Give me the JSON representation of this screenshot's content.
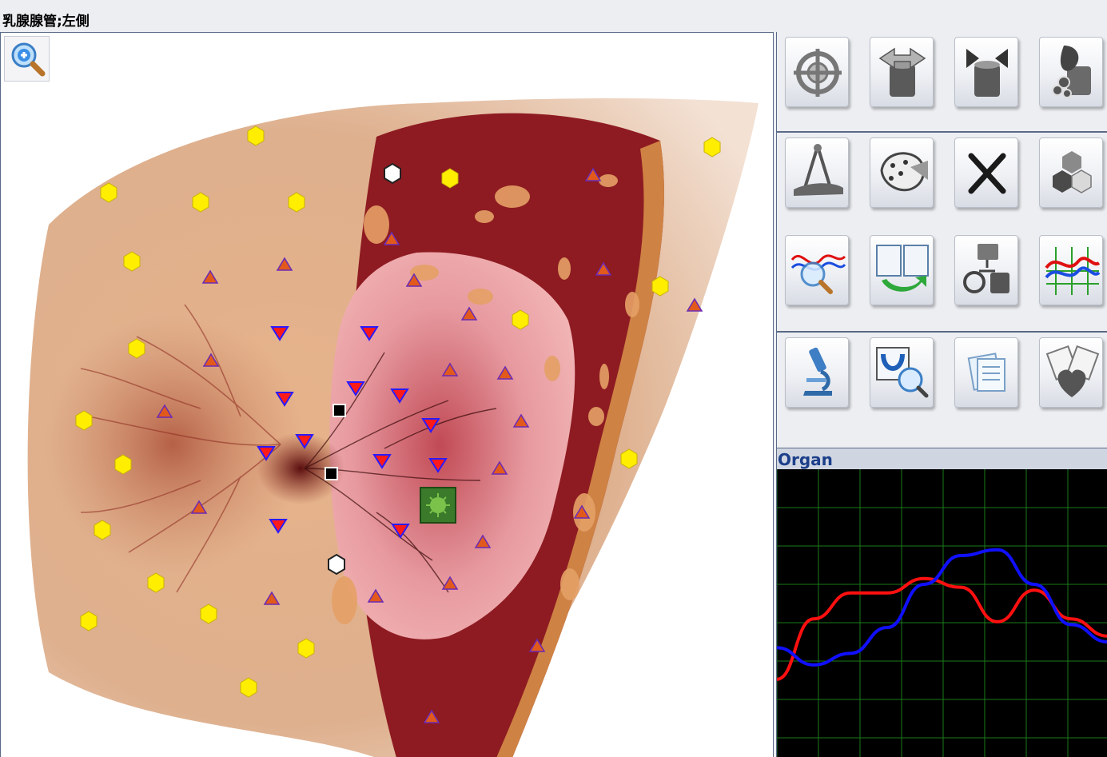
{
  "window": {
    "title": "乳腺腺管;左側"
  },
  "colors": {
    "marker_hexagon": "#ffee00",
    "marker_triangle": "#e25a1b",
    "marker_triangle_outline": "#6a2bb5",
    "marker_inverted": "#ff1a1a",
    "marker_inverted_outline": "#2a1aff",
    "graph_grid": "#1a7a1a",
    "curve_red": "#ff1010",
    "curve_blue": "#1010ff"
  },
  "toolbar": {
    "zoom_icon": "magnifier-plus-icon",
    "tools": [
      "crosshair-target-icon",
      "cylinder-expand-icon",
      "cylinder-contract-icon",
      "organ-cells-icon",
      "compass-measure-icon",
      "body-points-icon",
      "close-x-icon",
      "molecule-icon",
      "wave-magnifier-icon",
      "clipboard-exchange-icon",
      "device-cycle-icon",
      "spectrum-chart-icon",
      "microscope-icon",
      "tooth-scan-icon",
      "document-list-icon",
      "heart-report-icon"
    ]
  },
  "organ_panel": {
    "label": "Organ",
    "curves": [
      {
        "color": "red",
        "values": [
          0.73,
          0.52,
          0.43,
          0.43,
          0.38,
          0.41,
          0.53,
          0.42,
          0.52,
          0.58
        ]
      },
      {
        "color": "blue",
        "values": [
          0.62,
          0.68,
          0.64,
          0.55,
          0.4,
          0.3,
          0.28,
          0.4,
          0.54,
          0.6
        ]
      }
    ]
  }
}
